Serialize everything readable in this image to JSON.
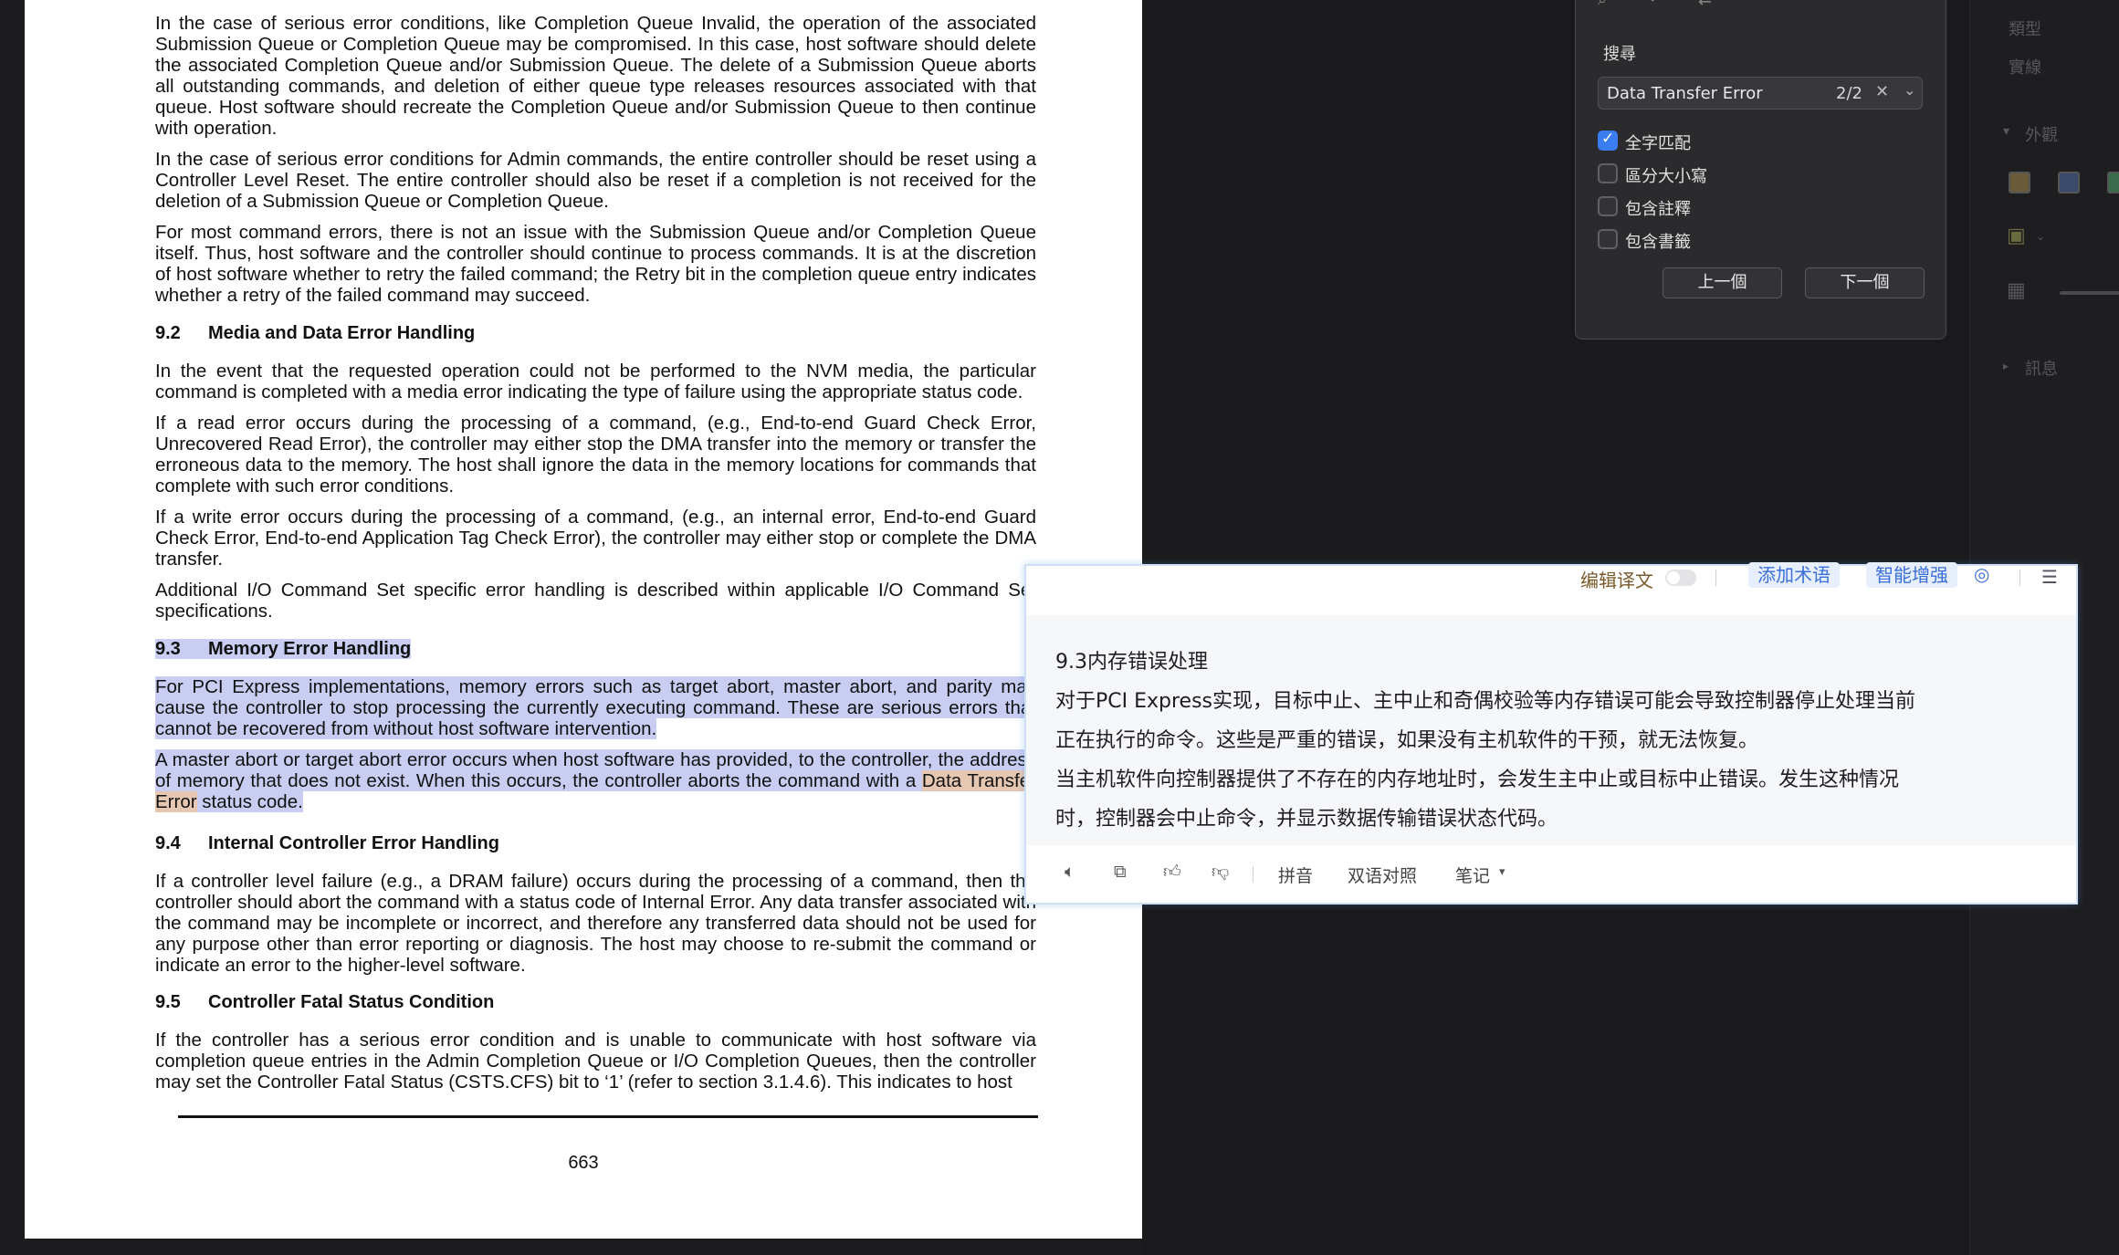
{
  "pdf": {
    "paragraphs_top": [
      "In the case of serious error conditions, like Completion Queue Invalid, the operation of the associated Submission Queue or Completion Queue may be compromised. In this case, host software should delete the associated Completion Queue and/or Submission Queue. The delete of a Submission Queue aborts all outstanding commands, and deletion of either queue type releases resources associated with that queue. Host software should recreate the Completion Queue and/or Submission Queue to then continue with operation.",
      "In the case of serious error conditions for Admin commands, the entire controller should be reset using a Controller Level Reset. The entire controller should also be reset if a completion is not received for the deletion of a Submission Queue or Completion Queue.",
      "For most command errors, there is not an issue with the Submission Queue and/or Completion Queue itself. Thus, host software and the controller should continue to process commands. It is at the discretion of host software whether to retry the failed command; the Retry bit in the completion queue entry indicates whether a retry of the failed command may succeed."
    ],
    "s92": {
      "num": "9.2",
      "title": "Media and Data Error Handling",
      "paragraphs": [
        "In the event that the requested operation could not be performed to the NVM media, the particular command is completed with a media error indicating the type of failure using the appropriate status code.",
        "If a read error occurs during the processing of a command, (e.g., End-to-end Guard Check Error, Unrecovered Read Error), the controller may either stop the DMA transfer into the memory or transfer the erroneous data to the memory. The host shall ignore the data in the memory locations for commands that complete with such error conditions.",
        "If a write error occurs during the processing of a command, (e.g., an internal error, End-to-end Guard Check Error, End-to-end Application Tag Check Error), the controller may either stop or complete the DMA transfer.",
        "Additional I/O Command Set specific error handling is described within applicable I/O Command Set specifications."
      ]
    },
    "s93": {
      "num": "9.3",
      "title": "Memory Error Handling",
      "p1": "For PCI Express implementations, memory errors such as target abort, master abort, and parity may cause the controller to stop processing the currently executing command. These are serious errors that cannot be recovered from without host software intervention.",
      "p2_a": "A master abort or target abort error occurs when host software has provided, to the controller, the address of memory that does not exist. When this occurs, the controller aborts the command with a ",
      "p2_hit": "Data Transfer Error",
      "p2_b": " status code."
    },
    "s94": {
      "num": "9.4",
      "title": "Internal Controller Error Handling",
      "p1": "If a controller level failure (e.g., a DRAM failure) occurs during the processing of a command, then the controller should abort the command with a status code of Internal Error. Any data transfer associated with the command may be incomplete or incorrect, and therefore any transferred data should not be used for any purpose other than error reporting or diagnosis. The host may choose to re-submit the command or indicate an error to the higher-level software."
    },
    "s95": {
      "num": "9.5",
      "title": "Controller Fatal Status Condition",
      "p1": "If the controller has a serious error condition and is unable to communicate with host software via completion queue entries in the Admin Completion Queue or I/O Completion Queues, then the controller may set the Controller Fatal Status (CSTS.CFS) bit to ‘1’ (refer to section 3.1.4.6). This indicates to host"
    },
    "page_number": "663"
  },
  "search_dialog": {
    "title": "搜尋",
    "query": "Data Transfer Error",
    "match_count": "2/2",
    "options": [
      {
        "label": "全字匹配",
        "checked": true
      },
      {
        "label": "區分大小寫",
        "checked": false
      },
      {
        "label": "包含註釋",
        "checked": false
      },
      {
        "label": "包含書籤",
        "checked": false
      }
    ],
    "prev_label": "上一個",
    "next_label": "下一個"
  },
  "right_panel": {
    "item_type": "類型",
    "item_line": "實線",
    "section_appearance": "外觀",
    "section_info": "訊息",
    "swatch_colors": [
      "#6b5a3a",
      "#3a4a6b",
      "#3a6b4a"
    ]
  },
  "translation": {
    "edit_label": "编辑译文",
    "add_term": "添加术语",
    "smart_enhance": "智能增强",
    "lines": [
      "9.3内存错误处理",
      "对于PCI Express实现，目标中止、主中止和奇偶校验等内存错误可能会导致控制器停止处理当前",
      "正在执行的命令。这些是严重的错误，如果没有主机软件的干预，就无法恢复。",
      "当主机软件向控制器提供了不存在的内存地址时，会发生主中止或目标中止错误。发生这种情况",
      "时，控制器会中止命令，并显示数据传输错误状态代码。"
    ],
    "pinyin": "拼音",
    "bilingual": "双语对照",
    "notes": "笔记"
  }
}
